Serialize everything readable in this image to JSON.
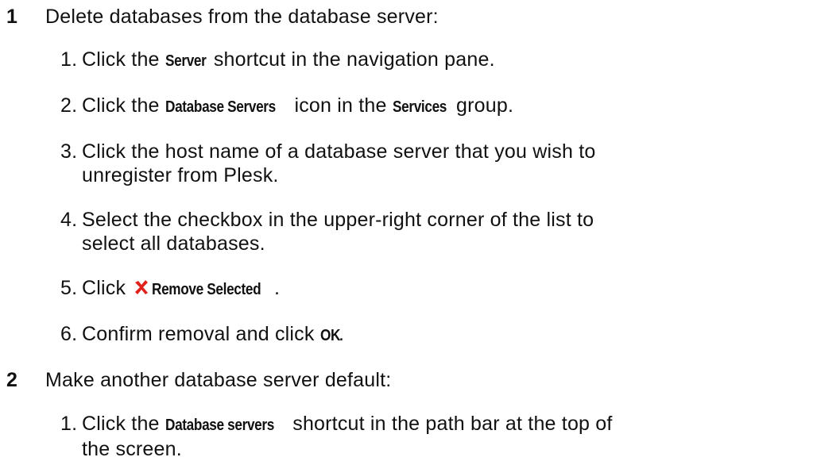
{
  "step1": {
    "number": "1",
    "text": "Delete databases from the database server:",
    "items": [
      {
        "n": "1.",
        "pre": "Click the ",
        "ui": "Server",
        "post": " shortcut in the navigation pane."
      },
      {
        "n": "2.",
        "pre": "Click the ",
        "ui": "Database Servers",
        "mid": " icon in the ",
        "ui2": "Services",
        "post": " group."
      },
      {
        "n": "3.",
        "line1": "Click the host name of a database server that you wish to",
        "line2": "unregister from Plesk."
      },
      {
        "n": "4.",
        "line1": "Select the checkbox in the upper-right corner of the list to",
        "line2": "select all databases."
      },
      {
        "n": "5.",
        "pre": "Click ",
        "icon": "remove-x-icon",
        "ui": "Remove Selected",
        "post": "."
      },
      {
        "n": "6.",
        "pre": "Confirm removal and click ",
        "ui": "OK",
        "post": "."
      }
    ]
  },
  "step2": {
    "number": "2",
    "text": "Make another database server default:",
    "items": [
      {
        "n": "1.",
        "pre": "Click the ",
        "ui": "Database servers",
        "post1": " shortcut in the path bar at the top of",
        "line2": "the screen."
      }
    ]
  },
  "colors": {
    "text": "#111111",
    "icon": "#e0201c",
    "background": "#ffffff"
  }
}
